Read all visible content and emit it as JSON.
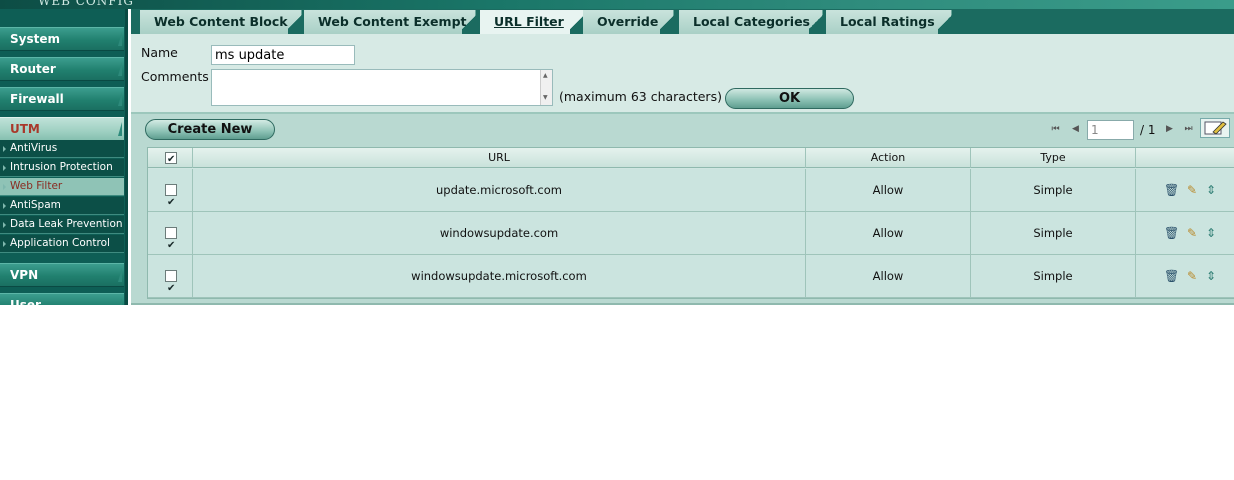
{
  "banner": {
    "logo_text": "WEB CONFIG"
  },
  "sidebar": {
    "items": [
      {
        "label": "System"
      },
      {
        "label": "Router"
      },
      {
        "label": "Firewall"
      },
      {
        "label": "UTM"
      },
      {
        "label": "VPN"
      },
      {
        "label": "User"
      }
    ],
    "utm_subitems": [
      {
        "label": "AntiVirus"
      },
      {
        "label": "Intrusion Protection"
      },
      {
        "label": "Web Filter"
      },
      {
        "label": "AntiSpam"
      },
      {
        "label": "Data Leak Prevention"
      },
      {
        "label": "Application Control"
      }
    ],
    "active_item": "UTM",
    "active_subitem": "Web Filter"
  },
  "tabs": [
    {
      "label": "Web Content Block"
    },
    {
      "label": "Web Content Exempt"
    },
    {
      "label": "URL Filter"
    },
    {
      "label": "Override"
    },
    {
      "label": "Local Categories"
    },
    {
      "label": "Local Ratings"
    }
  ],
  "active_tab": "URL Filter",
  "form": {
    "name_label": "Name",
    "name_value": "ms update",
    "comments_label": "Comments",
    "comments_value": "",
    "max_chars_note": "(maximum 63 characters)",
    "ok_label": "OK"
  },
  "toolbar": {
    "create_new_label": "Create New",
    "page_current": "1",
    "page_total": "/ 1"
  },
  "table": {
    "headers": {
      "url": "URL",
      "action": "Action",
      "type": "Type"
    },
    "rows": [
      {
        "checked": true,
        "url": "update.microsoft.com",
        "action": "Allow",
        "type": "Simple"
      },
      {
        "checked": true,
        "url": "windowsupdate.com",
        "action": "Allow",
        "type": "Simple"
      },
      {
        "checked": true,
        "url": "windowsupdate.microsoft.com",
        "action": "Allow",
        "type": "Simple"
      }
    ]
  },
  "colors": {
    "sidebar_bg": "#0e5e55",
    "active_nav_text": "#a9382a",
    "panel_bg": "#b9d9d1"
  }
}
